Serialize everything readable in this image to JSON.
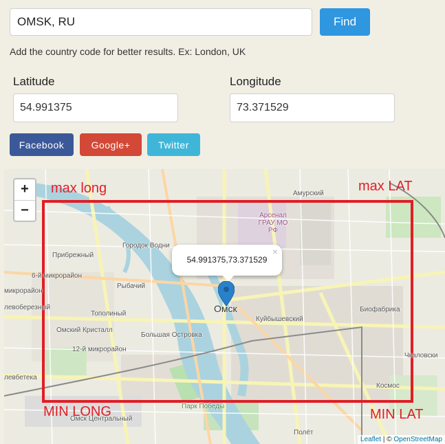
{
  "search": {
    "value": "OMSK, RU",
    "button": "Find",
    "hint": "Add the country code for better results. Ex: London, UK"
  },
  "latitude": {
    "label": "Latitude",
    "value": "54.991375"
  },
  "longitude": {
    "label": "Longitude",
    "value": "73.371529"
  },
  "share": {
    "facebook": "Facebook",
    "google": "Google+",
    "twitter": "Twitter"
  },
  "colors": {
    "find": "#2f96e0",
    "facebook": "#3b5998",
    "google": "#d34836",
    "twitter": "#3fb6d8",
    "annotation": "#e01e26"
  },
  "map": {
    "zoom_in": "+",
    "zoom_out": "−",
    "popup": "54.991375,73.371529",
    "popup_close": "×",
    "labels": {
      "omsk": "Омск",
      "amursky": "Амурский",
      "arsenal": "Арсенал ГРАУ МО РФ",
      "gorodok": "Городок Водни",
      "pribrezhny": "Прибрежный",
      "mkr6": "6-й микрорайон",
      "mkr_left": "микрорайон",
      "rybachy": "Рыбачий",
      "levoberezhny": "левоберезный",
      "topolinyi": "Тополиный",
      "kristall": "Омский Кристалл",
      "mkr12": "12-й микрорайон",
      "ostrovka": "Большая Островка",
      "kuibyshevsky": "Куйбышевский",
      "biofabrika": "Биофабрика",
      "chkalovsky": "Чкаловски",
      "kosmos": "Космос",
      "leveteka": "левбетека",
      "park": "Парк Победы",
      "omsk_central": "Омск Центральный",
      "polet": "Полёт"
    },
    "attribution": {
      "leaflet": "Leaflet",
      "sep": " | © ",
      "osm": "OpenStreetMap"
    }
  },
  "annotations": {
    "max_long": "max long",
    "max_lat": "max LAT",
    "min_long": "MIN LONG",
    "min_lat": "MIN LAT"
  }
}
